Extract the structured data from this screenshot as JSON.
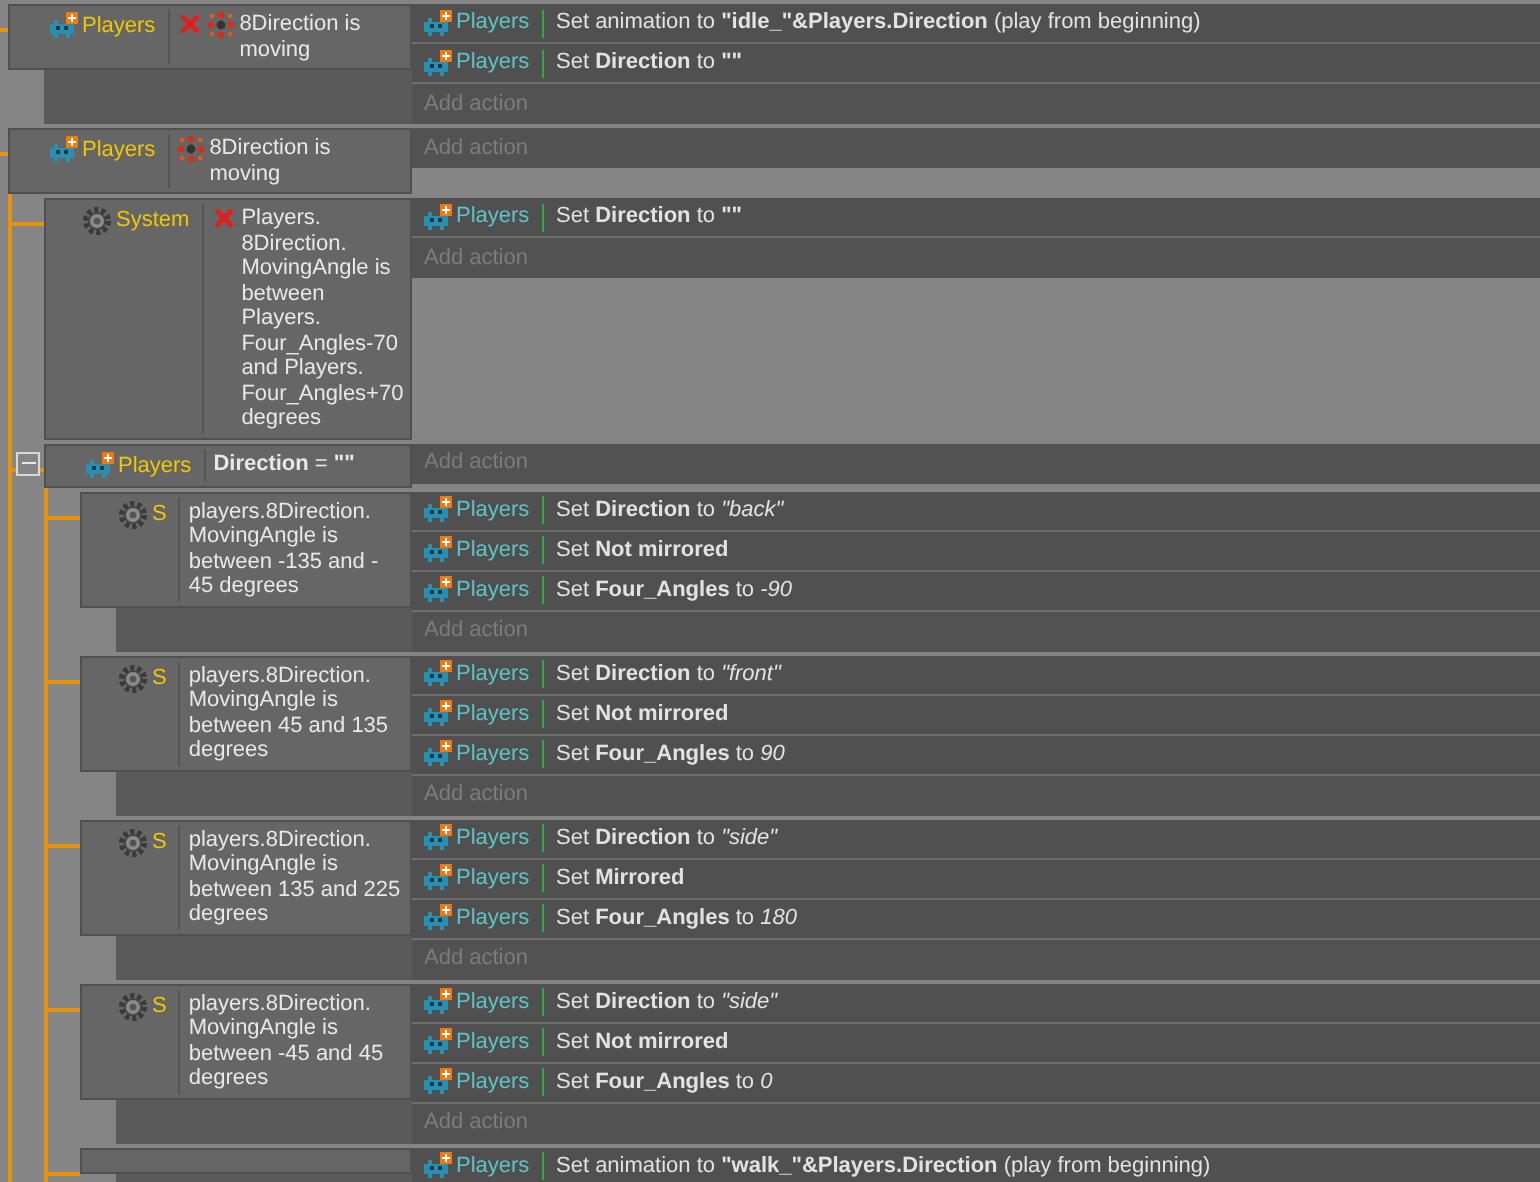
{
  "events": [
    {
      "conditions": [
        {
          "object": "Players",
          "kind": "behavior",
          "inverted": true,
          "text": "8Direction is moving"
        }
      ],
      "actions": [
        {
          "object": "Players",
          "text": "Set animation to **\"idle_\"&Players.Direction** (play from beginning)"
        },
        {
          "object": "Players",
          "text": "Set **Direction** to **\"\"**"
        }
      ],
      "add_action": "Add action"
    },
    {
      "conditions": [
        {
          "object": "Players",
          "kind": "behavior",
          "inverted": false,
          "text": "8Direction is moving"
        }
      ],
      "add_action": "Add action",
      "children": [
        {
          "conditions": [
            {
              "object": "System",
              "kind": "system",
              "inverted": true,
              "text": "Players. 8Direction. MovingAngle is between Players. Four_Angles-70 and Players. Four_Angles+70 degrees"
            }
          ],
          "actions": [
            {
              "object": "Players",
              "text": "Set **Direction** to **\"\"**"
            }
          ],
          "add_action": "Add action"
        },
        {
          "expanded": true,
          "conditions": [
            {
              "object": "Players",
              "kind": "variable",
              "inverted": false,
              "text": "**Direction** = **\"\"**"
            }
          ],
          "add_action": "Add action",
          "children": [
            {
              "conditions": [
                {
                  "object": "S",
                  "kind": "system",
                  "inverted": false,
                  "text": "players.8Direction. MovingAngle is between -135 and - 45 degrees"
                }
              ],
              "actions": [
                {
                  "object": "Players",
                  "text": "Set **Direction** to *\"back\"*"
                },
                {
                  "object": "Players",
                  "text": "Set **Not mirrored**"
                },
                {
                  "object": "Players",
                  "text": "Set **Four_Angles** to *-90*"
                }
              ],
              "add_action": "Add action"
            },
            {
              "conditions": [
                {
                  "object": "S",
                  "kind": "system",
                  "inverted": false,
                  "text": "players.8Direction. MovingAngle is between 45 and 135 degrees"
                }
              ],
              "actions": [
                {
                  "object": "Players",
                  "text": "Set **Direction** to *\"front\"*"
                },
                {
                  "object": "Players",
                  "text": "Set **Not mirrored**"
                },
                {
                  "object": "Players",
                  "text": "Set **Four_Angles** to *90*"
                }
              ],
              "add_action": "Add action"
            },
            {
              "conditions": [
                {
                  "object": "S",
                  "kind": "system",
                  "inverted": false,
                  "text": "players.8Direction. MovingAngle is between 135 and 225 degrees"
                }
              ],
              "actions": [
                {
                  "object": "Players",
                  "text": "Set **Direction** to *\"side\"*"
                },
                {
                  "object": "Players",
                  "text": "Set **Mirrored**"
                },
                {
                  "object": "Players",
                  "text": "Set **Four_Angles** to *180*"
                }
              ],
              "add_action": "Add action"
            },
            {
              "conditions": [
                {
                  "object": "S",
                  "kind": "system",
                  "inverted": false,
                  "text": "players.8Direction. MovingAngle is between -45 and 45 degrees"
                }
              ],
              "actions": [
                {
                  "object": "Players",
                  "text": "Set **Direction** to *\"side\"*"
                },
                {
                  "object": "Players",
                  "text": "Set **Not mirrored**"
                },
                {
                  "object": "Players",
                  "text": "Set **Four_Angles** to *0*"
                }
              ],
              "add_action": "Add action"
            },
            {
              "actions": [
                {
                  "object": "Players",
                  "text": "Set animation to **\"walk_\"&Players.Direction** (play from beginning)"
                }
              ]
            }
          ]
        }
      ]
    }
  ]
}
